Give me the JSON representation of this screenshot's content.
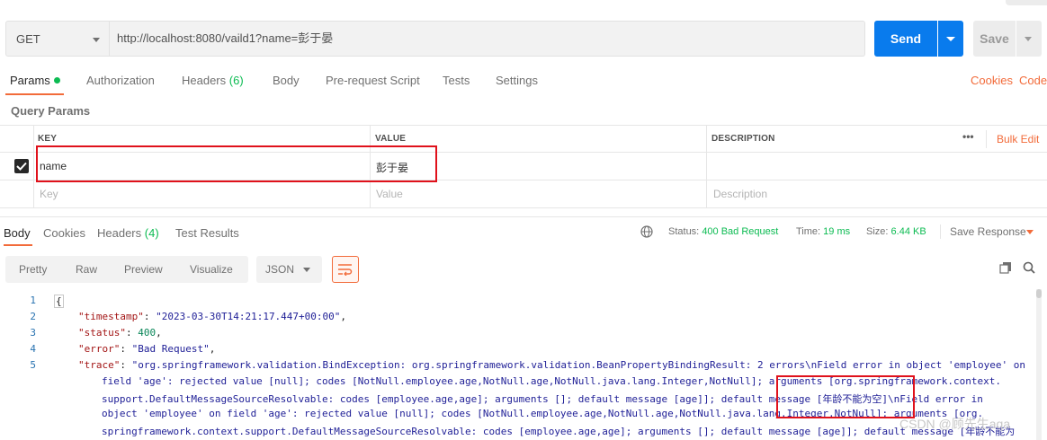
{
  "request": {
    "method": "GET",
    "url": "http://localhost:8080/vaild1?name=彭于晏",
    "send_label": "Send",
    "save_label": "Save"
  },
  "request_tabs": [
    {
      "label": "Params",
      "active": true
    },
    {
      "label": "Authorization"
    },
    {
      "label": "Headers",
      "count": "(6)"
    },
    {
      "label": "Body"
    },
    {
      "label": "Pre-request Script"
    },
    {
      "label": "Tests"
    },
    {
      "label": "Settings"
    }
  ],
  "request_links": {
    "cookies": "Cookies",
    "code": "Code"
  },
  "params": {
    "section_title": "Query Params",
    "headers": {
      "key": "KEY",
      "value": "VALUE",
      "description": "DESCRIPTION"
    },
    "more": "•••",
    "bulk_edit": "Bulk Edit",
    "rows": [
      {
        "key": "name",
        "value": "彭于晏",
        "description": "",
        "checked": true
      }
    ],
    "placeholders": {
      "key": "Key",
      "value": "Value",
      "description": "Description"
    }
  },
  "response_tabs": [
    {
      "label": "Body",
      "active": true
    },
    {
      "label": "Cookies"
    },
    {
      "label": "Headers",
      "count": "(4)"
    },
    {
      "label": "Test Results"
    }
  ],
  "response_meta": {
    "status_label": "Status:",
    "status_value": "400 Bad Request",
    "time_label": "Time:",
    "time_value": "19 ms",
    "size_label": "Size:",
    "size_value": "6.44 KB",
    "save_response": "Save Response"
  },
  "view_toolbar": {
    "pretty": "Pretty",
    "raw": "Raw",
    "preview": "Preview",
    "visualize": "Visualize",
    "format": "JSON"
  },
  "code_lines": [
    {
      "n": "1",
      "text": "{"
    },
    {
      "n": "2",
      "key": "\"timestamp\"",
      "val": "\"2023-03-30T14:21:17.447+00:00\"",
      "end": ","
    },
    {
      "n": "3",
      "key": "\"status\"",
      "val": "400",
      "end": ","
    },
    {
      "n": "4",
      "key": "\"error\"",
      "val": "\"Bad Request\"",
      "end": ","
    },
    {
      "n": "5",
      "key": "\"trace\"",
      "val": "\"org.springframework.validation.BindException: org.springframework.validation.BeanPropertyBindingResult: 2 errors\\nField error in object 'employee' on"
    }
  ],
  "trace_wrapped": [
    "field 'age': rejected value [null]; codes [NotNull.employee.age,NotNull.age,NotNull.java.lang.Integer,NotNull]; arguments [org.springframework.context.",
    "support.DefaultMessageSourceResolvable: codes [employee.age,age]; arguments []; default message [age]]; default message [年龄不能为空]\\nField error in",
    "object 'employee' on field 'age': rejected value [null]; codes [NotNull.employee.age,NotNull.age,NotNull.java.lang.Integer,NotNull]; arguments [org.",
    "springframework.context.support.DefaultMessageSourceResolvable: codes [employee.age,age]; arguments []; default message [age]]; default message [年龄不能为"
  ],
  "watermark": "CSDN @顾先生aqa",
  "colors": {
    "accent": "#f26b3a",
    "primary": "#097bed",
    "success": "#0cbb52",
    "highlight": "#e0111b"
  }
}
